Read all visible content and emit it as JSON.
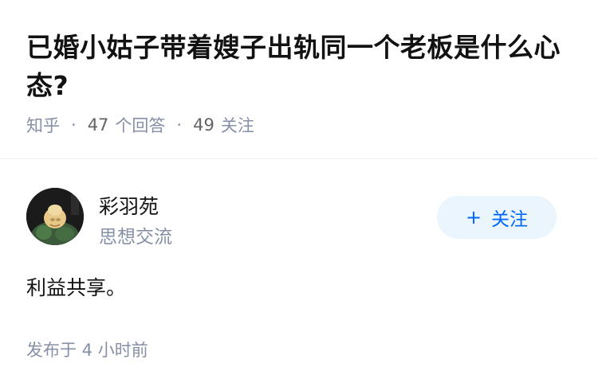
{
  "question": {
    "title": "已婚小姑子带着嫂子出轨同一个老板是什么心态?",
    "source": "知乎",
    "answer_count": "47",
    "answer_label": "个回答",
    "follower_count": "49",
    "follower_label": "关注"
  },
  "author": {
    "name": "彩羽苑",
    "description": "思想交流"
  },
  "follow_button": {
    "icon": "+",
    "label": "关注"
  },
  "answer": {
    "content": "利益共享。",
    "published": "发布于 4 小时前"
  },
  "colors": {
    "text_primary": "#121212",
    "text_secondary": "#8590a6",
    "accent": "#0066ff",
    "button_bg": "#ebf5fd"
  }
}
